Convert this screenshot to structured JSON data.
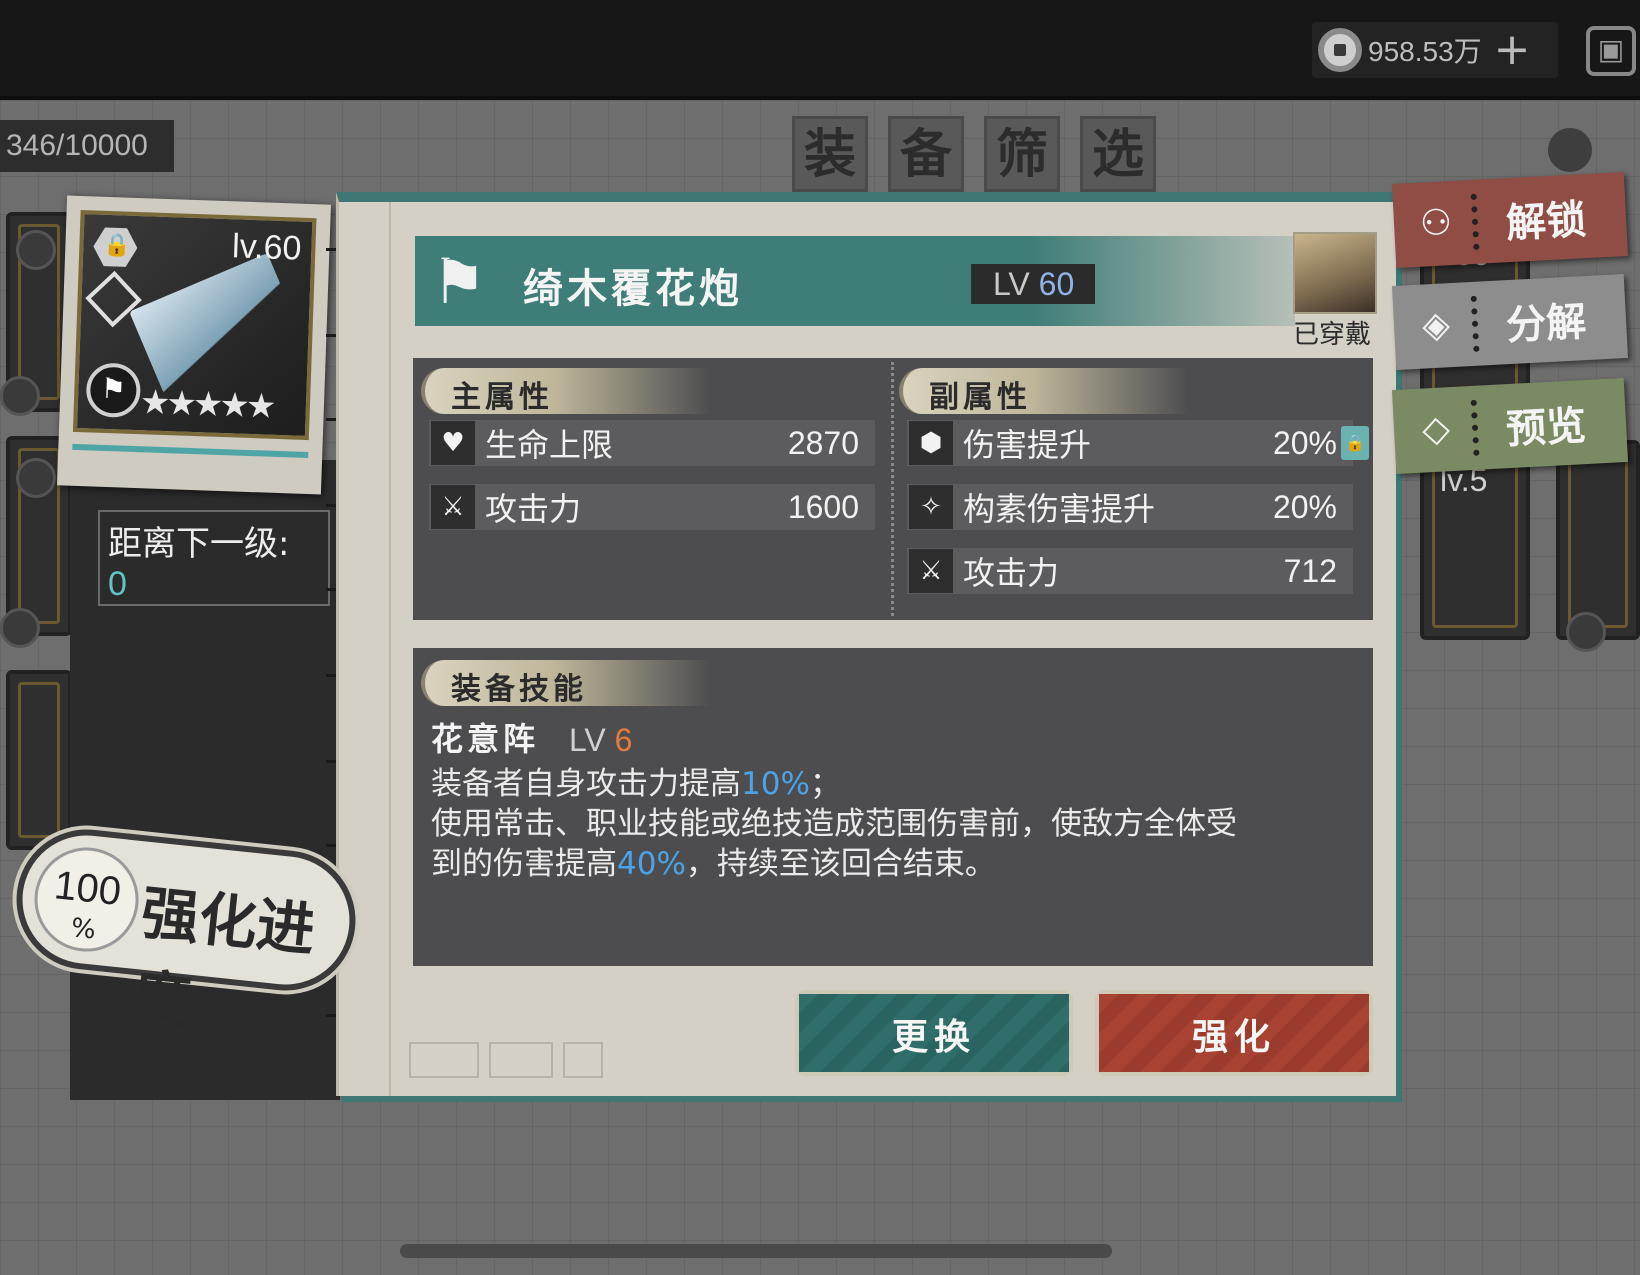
{
  "topbar": {
    "currency_icon": "coin-icon",
    "currency_value": "958.53万",
    "plus_label": "+",
    "menu_icon": "menu-icon"
  },
  "inventory": {
    "count": "346/10000"
  },
  "filter": {
    "title_chars": [
      "装",
      "备",
      "筛",
      "选"
    ]
  },
  "equipment_card": {
    "level": "lv.60",
    "stars": "★★★★★",
    "lock_icon": "lock-icon",
    "class_icon": "diamond-class-icon",
    "type_icon": "flag-icon"
  },
  "next_level": {
    "label": "距离下一级:",
    "value": "0"
  },
  "enhance_progress": {
    "value": "100",
    "unit": "%",
    "label": "强化进度"
  },
  "item": {
    "name": "绮木覆花炮",
    "level_prefix": "LV ",
    "level_value": "60",
    "equipped_label": "已穿戴"
  },
  "main_attributes": {
    "title": "主属性",
    "rows": [
      {
        "icon": "heart-icon",
        "name": "生命上限",
        "value": "2870"
      },
      {
        "icon": "crossed-swords-icon",
        "name": "攻击力",
        "value": "1600"
      }
    ]
  },
  "sub_attributes": {
    "title": "副属性",
    "rows": [
      {
        "icon": "damage-up-icon",
        "name": "伤害提升",
        "value": "20%"
      },
      {
        "icon": "element-damage-icon",
        "name": "构素伤害提升",
        "value": "20%"
      },
      {
        "icon": "crossed-swords-icon",
        "name": "攻击力",
        "value": "712"
      }
    ]
  },
  "skill": {
    "section_title": "装备技能",
    "name": "花意阵",
    "level_prefix": "LV ",
    "level_value": "6",
    "line1_a": "装备者自身攻击力提高",
    "line1_hl": "10%",
    "line1_b": "；",
    "line2": "使用常击、职业技能或绝技造成范围伤害前，使敌方全体受",
    "line3_a": "到的伤害提高",
    "line3_hl": "40%",
    "line3_b": "，持续至该回合结束。"
  },
  "buttons": {
    "replace": "更换",
    "enhance": "强化"
  },
  "side_actions": [
    {
      "icon": "unlock-icon",
      "label": "解锁"
    },
    {
      "icon": "decompose-icon",
      "label": "分解"
    },
    {
      "icon": "preview-icon",
      "label": "预览"
    }
  ],
  "background": {
    "card_level_1": "v.60",
    "card_level_2": "lv.5"
  },
  "colors": {
    "teal": "#3f7d79",
    "red_button": "#a84232",
    "highlight_blue": "#4aa3e8",
    "skill_level_orange": "#e47a3c"
  }
}
